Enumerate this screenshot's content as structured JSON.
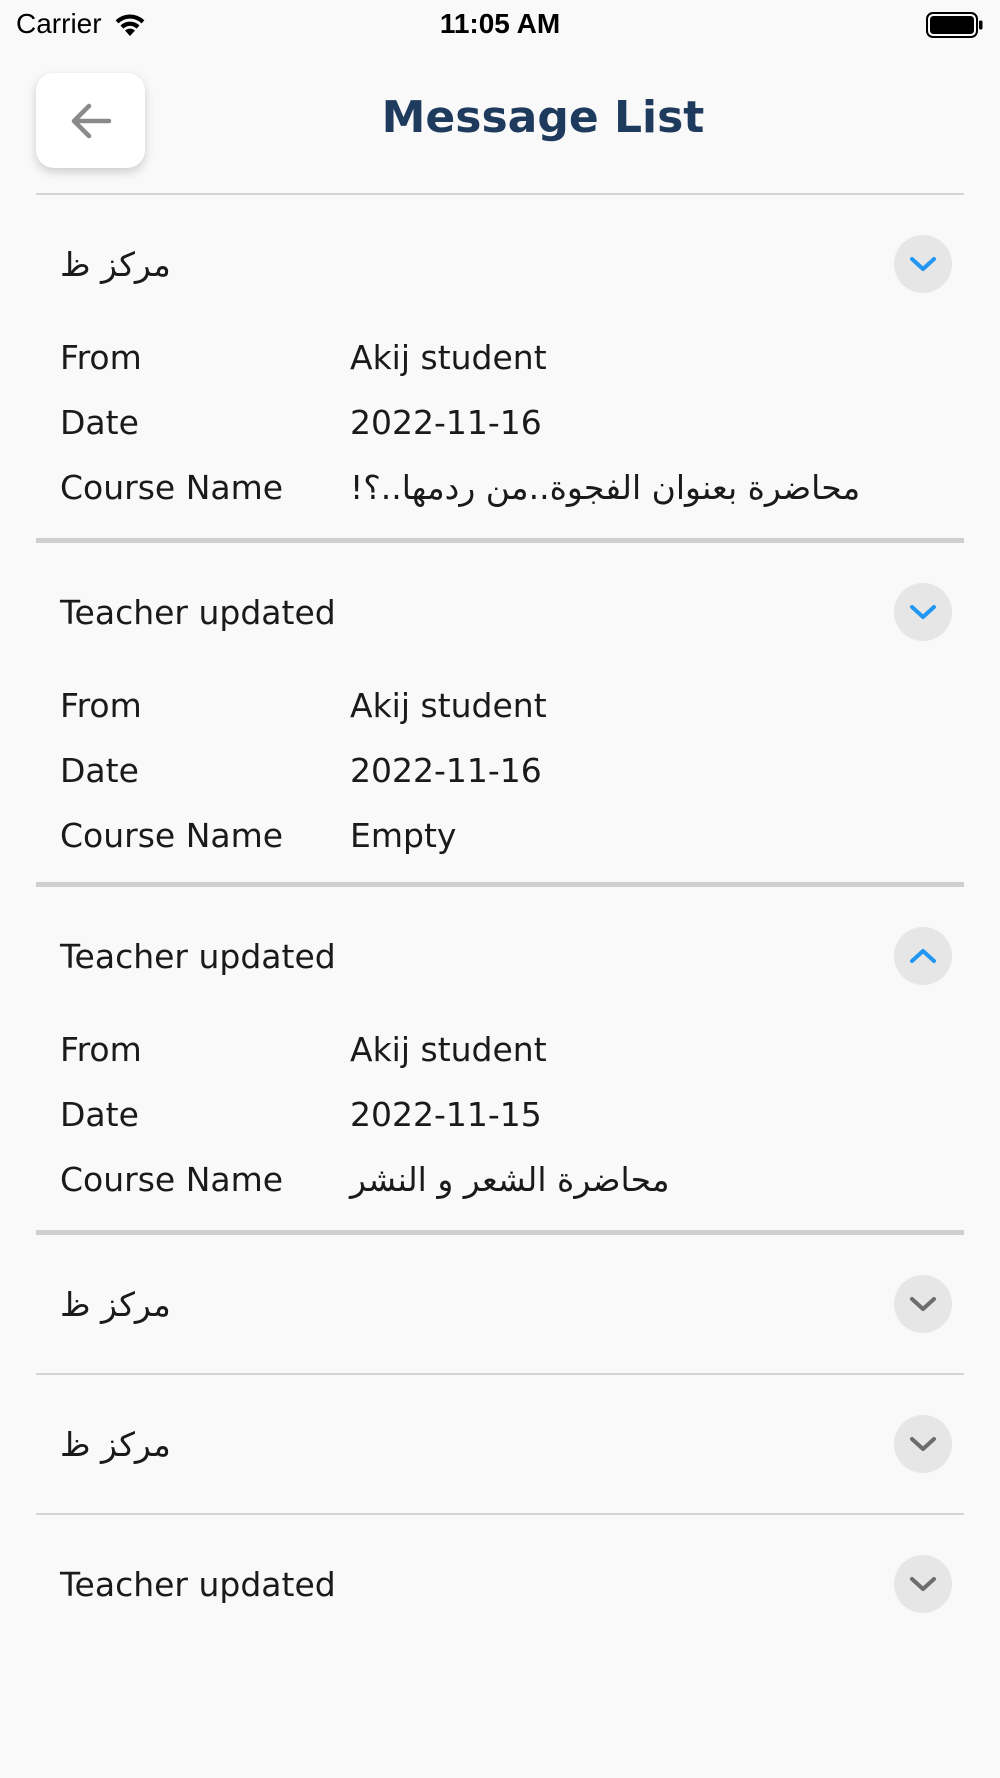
{
  "status_bar": {
    "carrier": "Carrier",
    "time": "11:05 AM"
  },
  "header": {
    "title": "Message List"
  },
  "labels": {
    "from": "From",
    "date": "Date",
    "course_name": "Course Name"
  },
  "colors": {
    "accent": "#2196f3",
    "title": "#1e3a5c",
    "chevron_inactive": "#6d6d6d"
  },
  "messages": [
    {
      "title": "مركز ظ",
      "expanded": true,
      "chevron_icon": "chevron-down-icon",
      "from": "Akij student",
      "date": "2022-11-16",
      "course_name": "!محاضرة بعنوان الفجوة..من ردمها..؟"
    },
    {
      "title": "Teacher updated",
      "expanded": true,
      "chevron_icon": "chevron-down-icon",
      "from": "Akij student",
      "date": "2022-11-16",
      "course_name": "Empty"
    },
    {
      "title": "Teacher updated",
      "expanded": true,
      "chevron_icon": "chevron-up-icon",
      "from": "Akij student",
      "date": "2022-11-15",
      "course_name": "محاضرة الشعر و النشر"
    },
    {
      "title": "مركز ظ",
      "expanded": false,
      "chevron_icon": "chevron-down-icon"
    },
    {
      "title": "مركز ظ",
      "expanded": false,
      "chevron_icon": "chevron-down-icon"
    },
    {
      "title": "Teacher updated",
      "expanded": false,
      "chevron_icon": "chevron-down-icon"
    }
  ]
}
